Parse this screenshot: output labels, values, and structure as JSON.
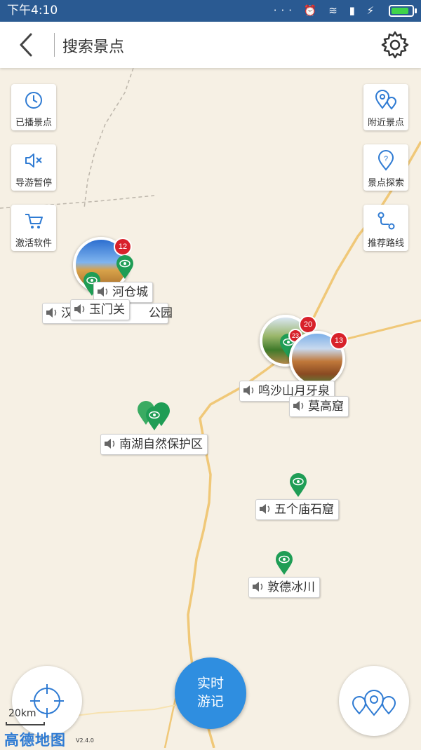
{
  "status": {
    "time": "下午4:10"
  },
  "header": {
    "title": "搜索景点"
  },
  "left_buttons": [
    {
      "label": "已播景点",
      "icon": "history-clock-icon"
    },
    {
      "label": "导游暂停",
      "icon": "speaker-mute-icon"
    },
    {
      "label": "激活软件",
      "icon": "shopping-cart-icon"
    }
  ],
  "right_buttons": [
    {
      "label": "附近景点",
      "icon": "nearby-pins-icon"
    },
    {
      "label": "景点探索",
      "icon": "question-pin-icon"
    },
    {
      "label": "推荐路线",
      "icon": "route-icon"
    }
  ],
  "badges": {
    "cluster_west": "12",
    "cluster_east_a": "20",
    "cluster_east_b": "13",
    "cluster_east_c": "23"
  },
  "labels": {
    "hecang": "河仓城",
    "yumen": "玉门关",
    "park": "公园",
    "park_prefix": "汉",
    "mingsha": "鸣沙山月牙泉",
    "mogao": "莫高窟",
    "nanhu": "南湖自然保护区",
    "wuge": "五个庙石窟",
    "dunde": "敦德冰川"
  },
  "bottom": {
    "travel_line1": "实时",
    "travel_line2": "游记",
    "scale": "20km",
    "logo": "高德地图",
    "version": "V2.4.0"
  },
  "colors": {
    "accent": "#2f8ee0",
    "pin_green": "#1f9d55",
    "badge_red": "#d8212a",
    "statusbar": "#2a5a92"
  }
}
